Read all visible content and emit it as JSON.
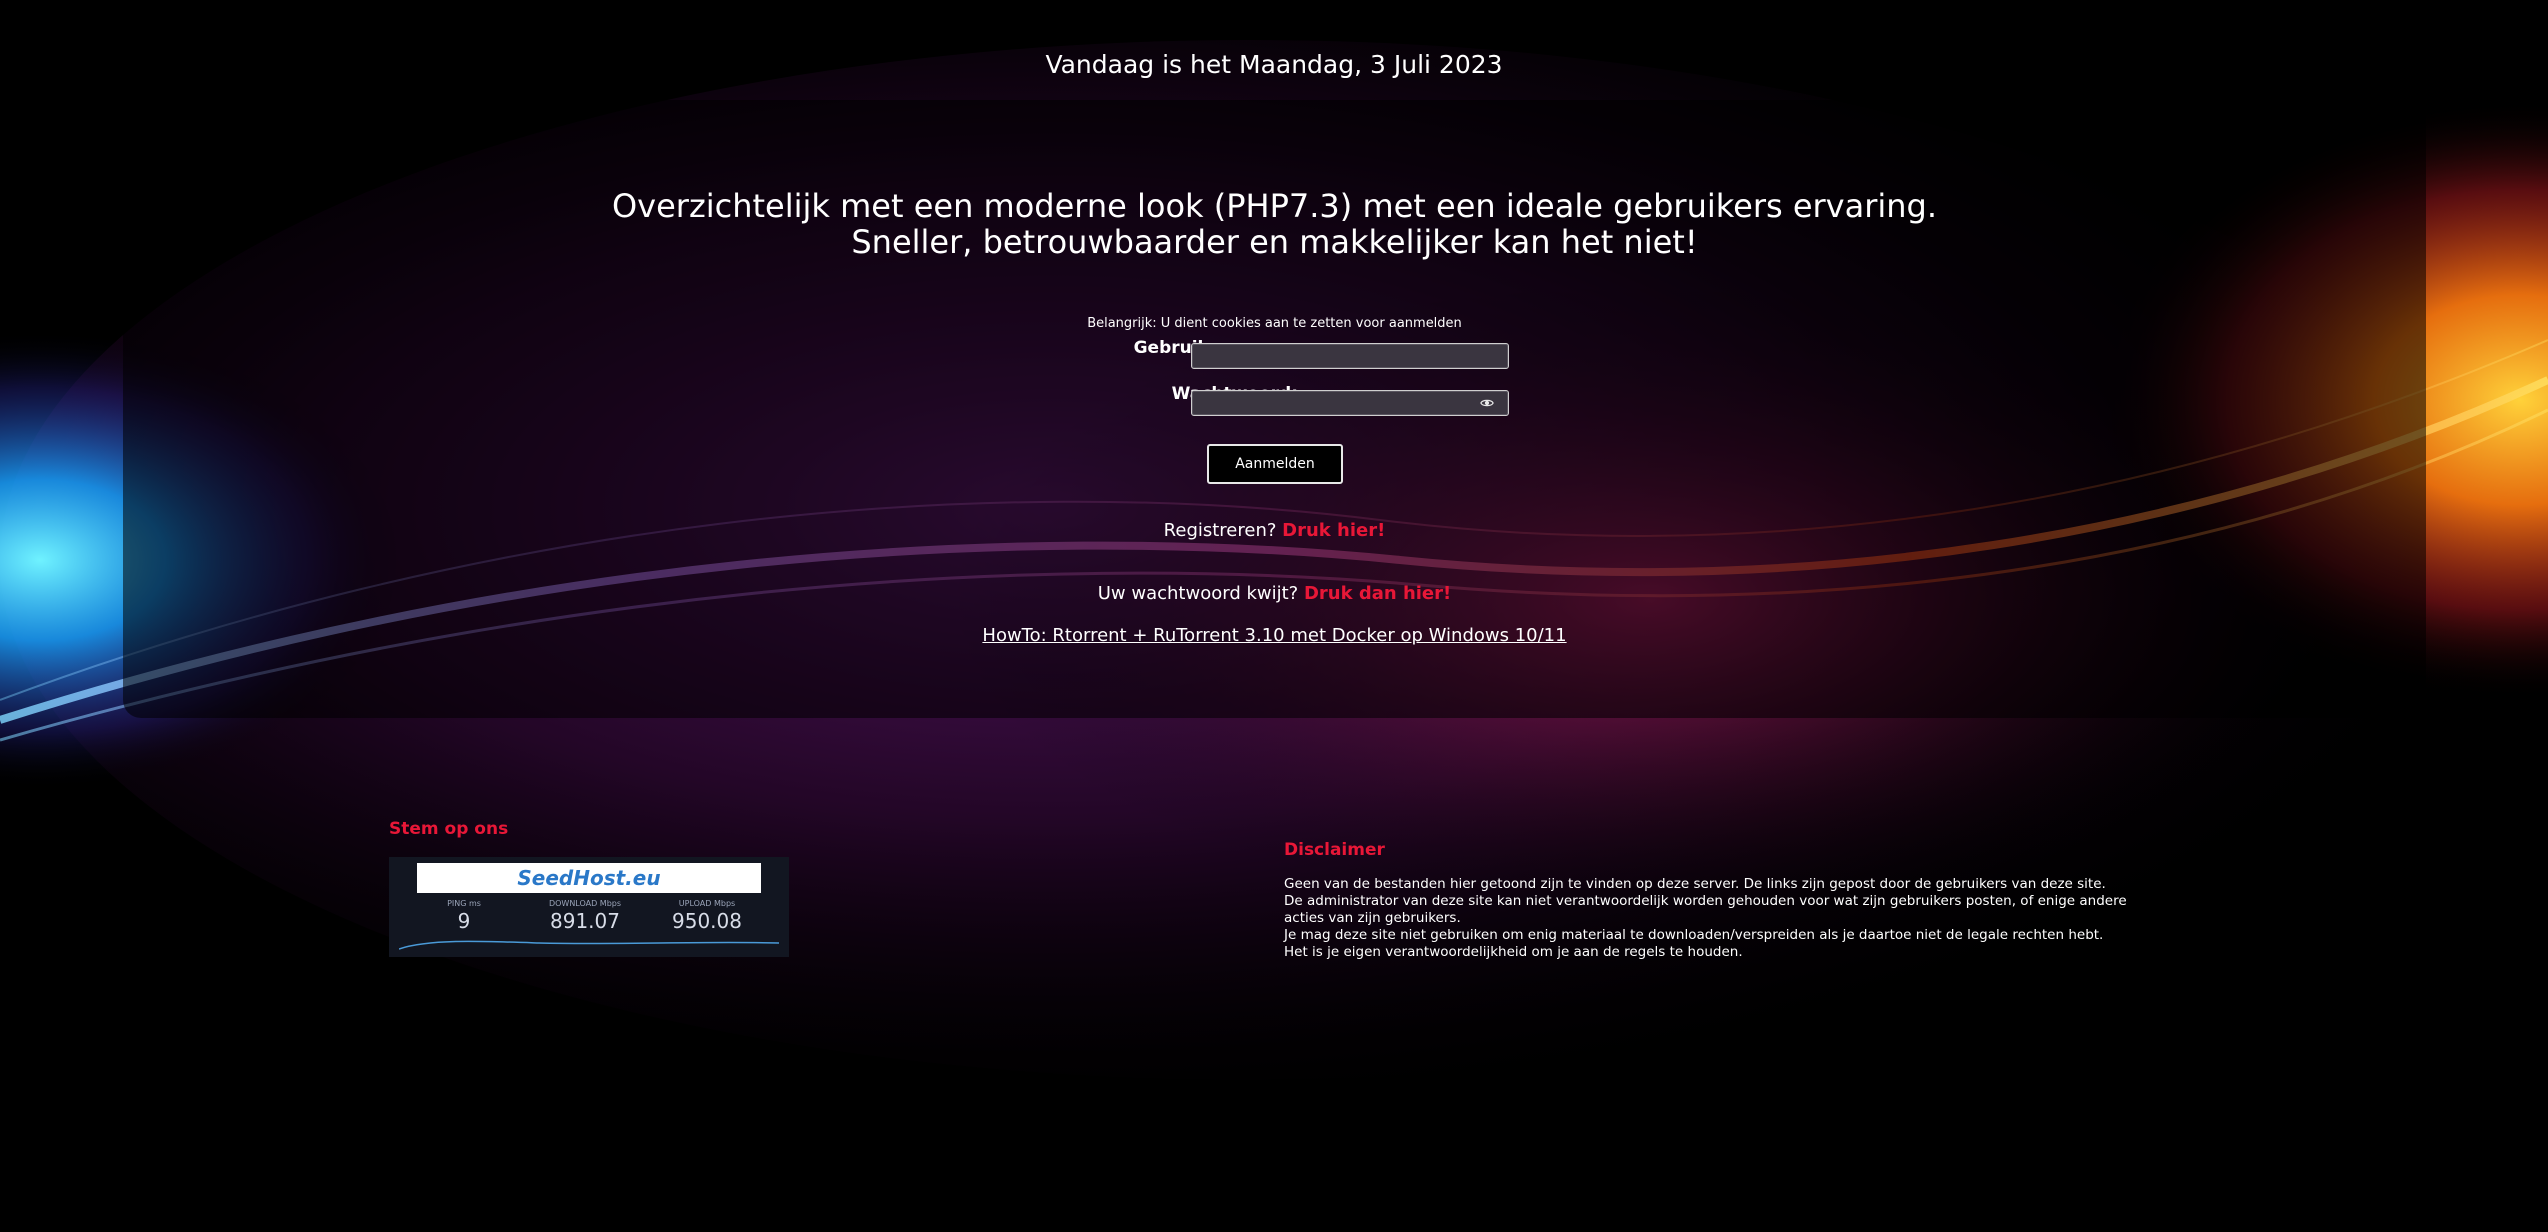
{
  "date_line": "Vandaag is het Maandag, 3 Juli 2023",
  "headline": {
    "line1": "Overzichtelijk met een moderne look (PHP7.3) met een ideale gebruikers ervaring.",
    "line2": "Sneller, betrouwbaarder en makkelijker kan het niet!"
  },
  "login": {
    "cookie_note": "Belangrijk: U dient cookies aan te zetten voor aanmelden",
    "username_label": "Gebruikersnaam:",
    "username_value": "",
    "password_label": "Wachtwoord:",
    "password_value": "",
    "submit_label": "Aanmelden"
  },
  "register": {
    "text": "Registreren?",
    "link": "Druk hier!"
  },
  "forgot": {
    "text": "Uw wachtwoord kwijt?",
    "link": "Druk dan hier!"
  },
  "howto_link": "HowTo: Rtorrent + RuTorrent 3.10 met Docker op Windows 10/11",
  "vote": {
    "title": "Stem op ons",
    "banner": {
      "logo_text": "SeedHost.eu",
      "metrics": [
        {
          "label": "PING ms",
          "value": "9"
        },
        {
          "label": "DOWNLOAD Mbps",
          "value": "891.07"
        },
        {
          "label": "UPLOAD Mbps",
          "value": "950.08"
        }
      ]
    }
  },
  "disclaimer": {
    "title": "Disclaimer",
    "lines": [
      "Geen van de bestanden hier getoond zijn te vinden op deze server. De links zijn gepost door de gebruikers van deze site.",
      "De administrator van deze site kan niet verantwoordelijk worden gehouden voor wat zijn gebruikers posten, of enige andere acties van zijn gebruikers.",
      "Je mag deze site niet gebruiken om enig materiaal te downloaden/verspreiden als je daartoe niet de legale rechten hebt.",
      "Het is je eigen verantwoordelijkheid om je aan de regels te houden."
    ]
  },
  "colors": {
    "accent_red": "#e81737",
    "background": "#000000"
  },
  "icons": {
    "password_toggle": "eye-icon"
  }
}
